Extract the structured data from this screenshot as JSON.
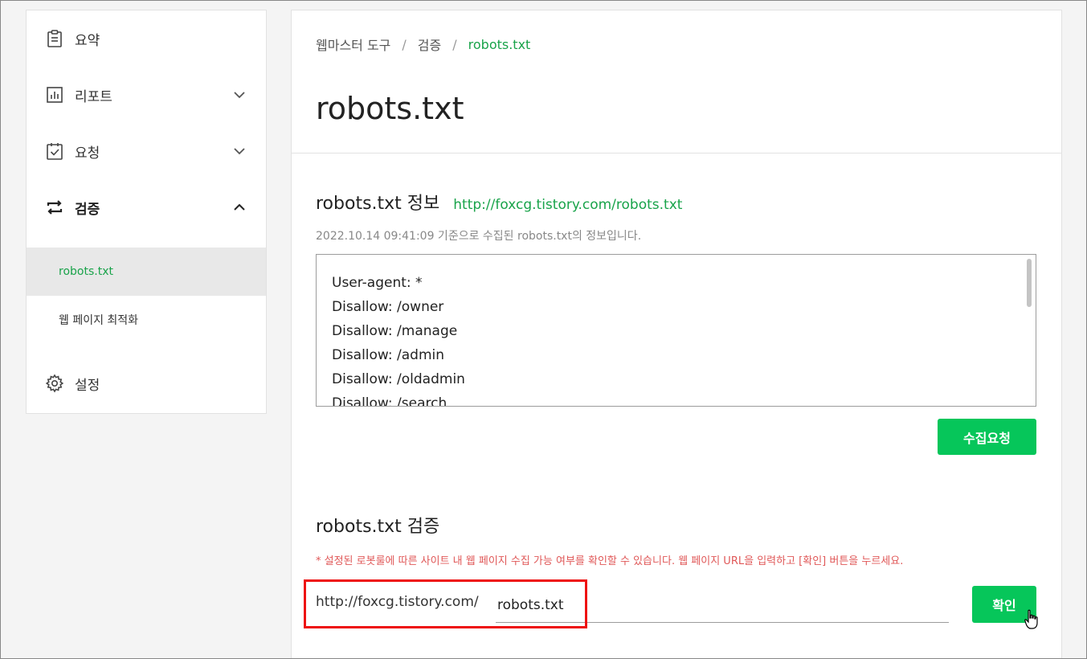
{
  "sidebar": {
    "items": [
      {
        "label": "요약",
        "icon": "clipboard-icon"
      },
      {
        "label": "리포트",
        "icon": "chart-icon"
      },
      {
        "label": "요청",
        "icon": "checklist-icon"
      },
      {
        "label": "검증",
        "icon": "sync-arrows-icon"
      },
      {
        "label": "설정",
        "icon": "gear-icon"
      }
    ],
    "subitems": [
      {
        "label": "robots.txt",
        "active": true
      },
      {
        "label": "웹 페이지 최적화",
        "active": false
      }
    ]
  },
  "breadcrumb": [
    "웹마스터 도구",
    "검증",
    "robots.txt"
  ],
  "page_title": "robots.txt",
  "info_section": {
    "title": "robots.txt 정보",
    "link": "http://foxcg.tistory.com/robots.txt",
    "description": "2022.10.14 09:41:09 기준으로 수집된 robots.txt의 정보입니다.",
    "lines": [
      "User-agent: *",
      "Disallow: /owner",
      "Disallow: /manage",
      "Disallow: /admin",
      "Disallow: /oldadmin",
      "Disallow: /search"
    ],
    "button": "수집요청"
  },
  "verify_section": {
    "title": "robots.txt 검증",
    "notice": "* 설정된 로봇룰에 따른 사이트 내 웹 페이지 수집 가능 여부를 확인할 수 있습니다. 웹 페이지 URL을 입력하고 [확인] 버튼을 누르세요.",
    "url_prefix": "http://foxcg.tistory.com/",
    "input_value": "robots.txt",
    "button": "확인"
  },
  "colors": {
    "accent": "#06c65a",
    "link": "#19a34a",
    "notice": "#e05858",
    "highlight": "#e11111"
  }
}
